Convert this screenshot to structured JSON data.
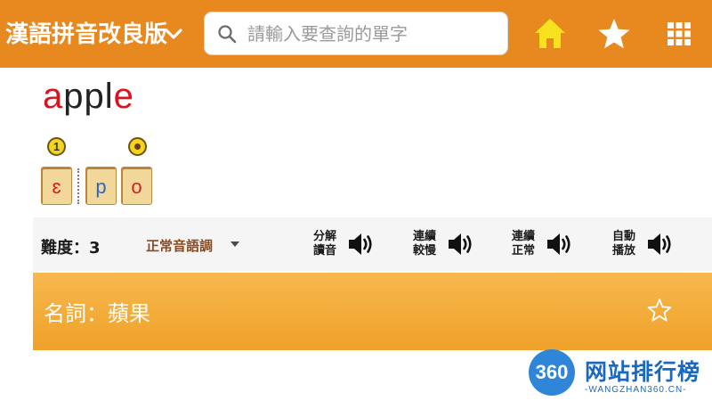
{
  "header": {
    "app_title": "漢語拼音改良版",
    "search_placeholder": "請輸入要查詢的單字",
    "search_value": "",
    "icons": [
      "chevron-down-icon",
      "search-icon",
      "home-icon",
      "star-icon",
      "grid-icon"
    ]
  },
  "word": {
    "letters": [
      {
        "char": "a",
        "color": "#d9141f"
      },
      {
        "char": "p",
        "color": "#222222"
      },
      {
        "char": "p",
        "color": "#222222"
      },
      {
        "char": "l",
        "color": "#222222"
      },
      {
        "char": "e",
        "color": "#d9141f"
      }
    ]
  },
  "pronunciation": {
    "markers": [
      "1"
    ],
    "tiles": [
      "ɛ",
      "p",
      "o"
    ]
  },
  "controls": {
    "difficulty": "難度：3",
    "tone_mode": "正常音語調",
    "buttons": [
      {
        "label": "分解讀音"
      },
      {
        "label": "連續較慢"
      },
      {
        "label": "連續正常"
      },
      {
        "label": "自動播放"
      }
    ]
  },
  "definition": {
    "text": "名詞：蘋果"
  },
  "watermark": {
    "logo_number": "360",
    "name": "网站排行榜",
    "domain": "-WANGZHAN360.CN-"
  },
  "colors": {
    "header_bg": "#e8891f",
    "home_icon": "#f7e21d",
    "accent_red": "#d9141f",
    "definition_bg": "#f0a129",
    "tone_text": "#8b4a1f"
  }
}
